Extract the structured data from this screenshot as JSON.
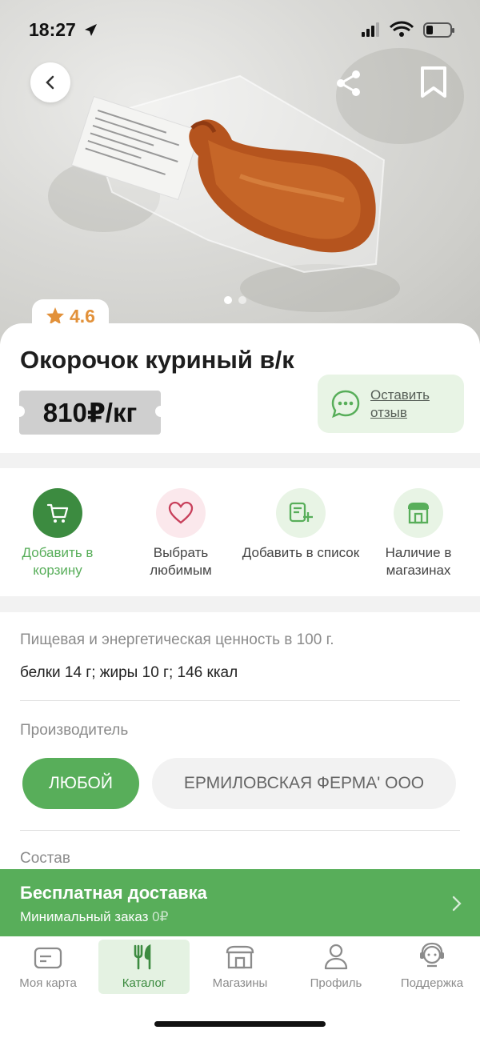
{
  "status": {
    "time": "18:27"
  },
  "product": {
    "rating": "4.6",
    "title": "Окорочок куриный в/к",
    "price": "810₽/кг",
    "review_label": "Оставить отзыв"
  },
  "actions": [
    {
      "label": "Добавить в корзину",
      "icon": "cart-icon"
    },
    {
      "label": "Выбрать любимым",
      "icon": "heart-icon"
    },
    {
      "label": "Добавить в список",
      "icon": "add-list-icon"
    },
    {
      "label": "Наличие в магазинах",
      "icon": "store-icon"
    }
  ],
  "info": {
    "nutrition_heading": "Пищевая и энергетическая ценность в 100 г.",
    "nutrition_value": "белки 14 г; жиры 10 г; 146 ккал",
    "producer_heading": "Производитель",
    "producer_chips": [
      "ЛЮБОЙ",
      "ЕРМИЛОВСКАЯ ФЕРМА' ООО"
    ],
    "composition_heading": "Состав"
  },
  "delivery": {
    "title": "Бесплатная доставка",
    "subtitle_label": "Минимальный заказ",
    "subtitle_value": "0₽"
  },
  "tabs": [
    {
      "label": "Моя карта",
      "icon": "card-icon"
    },
    {
      "label": "Каталог",
      "icon": "catalog-icon"
    },
    {
      "label": "Магазины",
      "icon": "shops-icon"
    },
    {
      "label": "Профиль",
      "icon": "profile-icon"
    },
    {
      "label": "Поддержка",
      "icon": "support-icon"
    }
  ],
  "colors": {
    "brand_green": "#58ae5a",
    "accent_orange": "#e2913a",
    "dark_green": "#3c8b40"
  }
}
